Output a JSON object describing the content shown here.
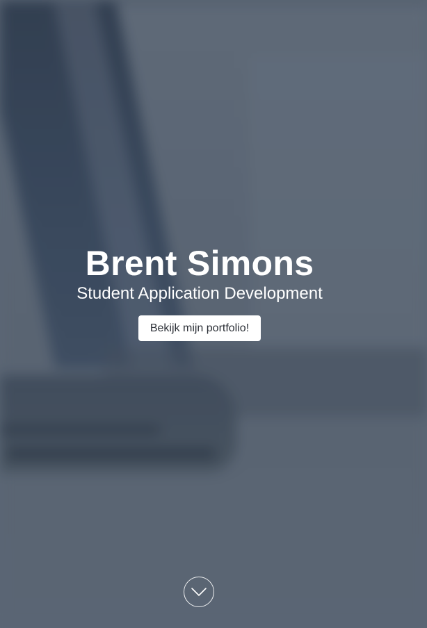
{
  "hero": {
    "title": "Brent Simons",
    "subtitle": "Student Application Development",
    "cta_label": "Bekijk mijn portfolio!",
    "scroll_icon": "chevron-down-icon"
  },
  "colors": {
    "overlay": "#5f6b79",
    "text": "#ffffff",
    "button_bg": "#ffffff",
    "button_text": "#2b2f36"
  }
}
